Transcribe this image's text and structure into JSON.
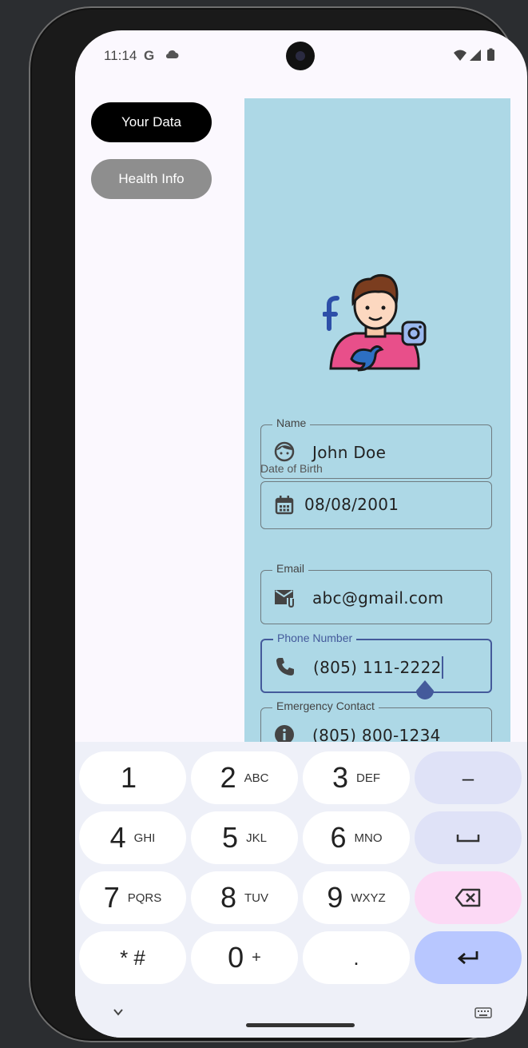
{
  "status": {
    "time": "11:14",
    "g_label": "G"
  },
  "nav": {
    "your_data": "Your Data",
    "health_info": "Health Info"
  },
  "form": {
    "name_label": "Name",
    "name_value": "John Doe",
    "dob_label": "Date of Birth",
    "dob_value": "08/08/2001",
    "email_label": "Email",
    "email_value": "abc@gmail.com",
    "phone_label": "Phone Number",
    "phone_value": "(805) 111-2222",
    "emergency_label": "Emergency Contact",
    "emergency_value": "(805) 800-1234"
  },
  "keyboard": {
    "k1": {
      "num": "1",
      "letters": ""
    },
    "k2": {
      "num": "2",
      "letters": "ABC"
    },
    "k3": {
      "num": "3",
      "letters": "DEF"
    },
    "k4": {
      "num": "4",
      "letters": "GHI"
    },
    "k5": {
      "num": "5",
      "letters": "JKL"
    },
    "k6": {
      "num": "6",
      "letters": "MNO"
    },
    "k7": {
      "num": "7",
      "letters": "PQRS"
    },
    "k8": {
      "num": "8",
      "letters": "TUV"
    },
    "k9": {
      "num": "9",
      "letters": "WXYZ"
    },
    "k0": {
      "num": "0",
      "letters": "+"
    },
    "star_hash": "* #",
    "dot": ".",
    "minus": "–"
  },
  "colors": {
    "panel": "#add8e6",
    "focus": "#445a9b",
    "enter_key": "#b8c7ff",
    "delete_key": "#fcd9f5"
  }
}
